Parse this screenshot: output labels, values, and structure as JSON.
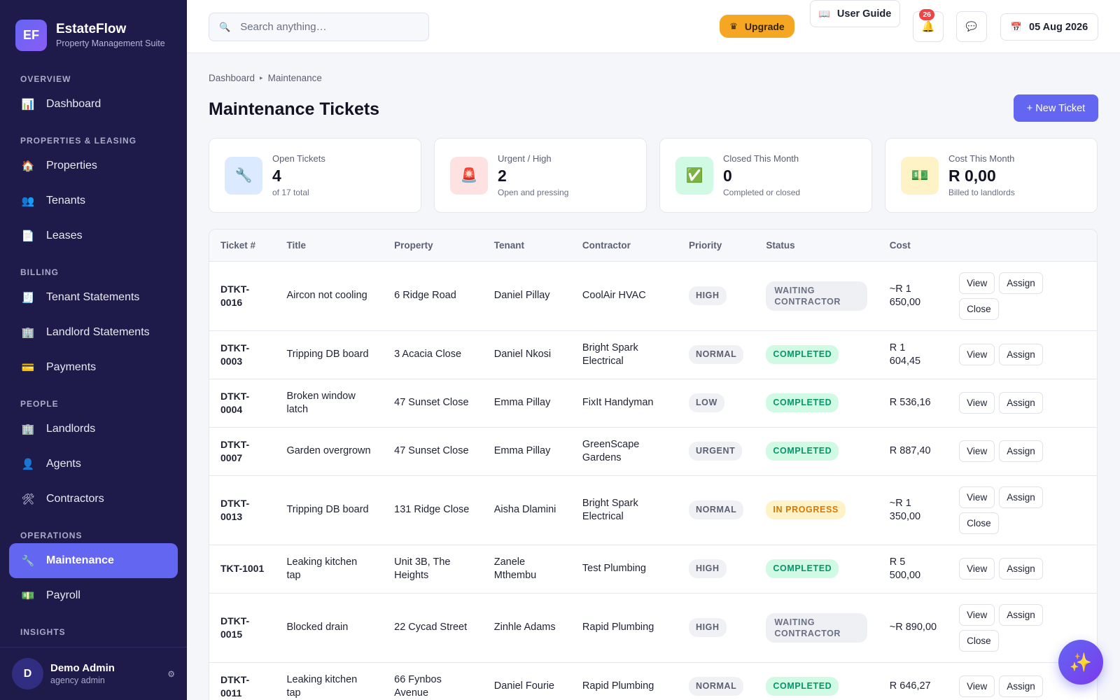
{
  "brand": {
    "logo": "EF",
    "name": "EstateFlow",
    "subtitle": "Property Management Suite"
  },
  "sidebar": {
    "sections": [
      {
        "title": "OVERVIEW",
        "items": [
          {
            "label": "Dashboard",
            "icon": "chart-icon"
          }
        ]
      },
      {
        "title": "PROPERTIES & LEASING",
        "items": [
          {
            "label": "Properties",
            "icon": "house-icon"
          },
          {
            "label": "Tenants",
            "icon": "people-icon"
          },
          {
            "label": "Leases",
            "icon": "document-icon"
          }
        ]
      },
      {
        "title": "BILLING",
        "items": [
          {
            "label": "Tenant Statements",
            "icon": "receipt-icon"
          },
          {
            "label": "Landlord Statements",
            "icon": "building-icon"
          },
          {
            "label": "Payments",
            "icon": "card-icon"
          }
        ]
      },
      {
        "title": "PEOPLE",
        "items": [
          {
            "label": "Landlords",
            "icon": "building-icon"
          },
          {
            "label": "Agents",
            "icon": "person-icon"
          },
          {
            "label": "Contractors",
            "icon": "tools-icon"
          }
        ]
      },
      {
        "title": "OPERATIONS",
        "items": [
          {
            "label": "Maintenance",
            "icon": "wrench-icon",
            "active": true
          },
          {
            "label": "Payroll",
            "icon": "money-icon"
          }
        ]
      },
      {
        "title": "INSIGHTS",
        "items": []
      }
    ],
    "user": {
      "initial": "D",
      "name": "Demo Admin",
      "role": "agency admin"
    }
  },
  "topbar": {
    "search_placeholder": "Search anything…",
    "upgrade_label": "Upgrade",
    "guide_label": "User Guide",
    "notification_count": "26",
    "date": "05 Aug 2026"
  },
  "breadcrumb": {
    "root": "Dashboard",
    "current": "Maintenance"
  },
  "page_title": "Maintenance Tickets",
  "new_ticket_label": "+ New Ticket",
  "stats": [
    {
      "label": "Open Tickets",
      "value": "4",
      "sub": "of 17 total",
      "icon": "wrench-icon",
      "bg": "#dbeafe"
    },
    {
      "label": "Urgent / High",
      "value": "2",
      "sub": "Open and pressing",
      "icon": "siren-icon",
      "bg": "#fee2e2"
    },
    {
      "label": "Closed This Month",
      "value": "0",
      "sub": "Completed or closed",
      "icon": "check-icon",
      "bg": "#d1fae5"
    },
    {
      "label": "Cost This Month",
      "value": "R 0,00",
      "sub": "Billed to landlords",
      "icon": "money-icon",
      "bg": "#fef3c7"
    }
  ],
  "table": {
    "headers": [
      "Ticket #",
      "Title",
      "Property",
      "Tenant",
      "Contractor",
      "Priority",
      "Status",
      "Cost",
      ""
    ],
    "rows": [
      {
        "ticket": "DTKT-0016",
        "title": "Aircon not cooling",
        "property": "6 Ridge Road",
        "tenant": "Daniel Pillay",
        "contractor": "CoolAir HVAC",
        "priority": "HIGH",
        "status": "WAITING CONTRACTOR",
        "status_kind": "wait",
        "cost": "~R 1 650,00",
        "actions": [
          "View",
          "Assign",
          "Close"
        ]
      },
      {
        "ticket": "DTKT-0003",
        "title": "Tripping DB board",
        "property": "3 Acacia Close",
        "tenant": "Daniel Nkosi",
        "contractor": "Bright Spark Electrical",
        "priority": "NORMAL",
        "status": "COMPLETED",
        "status_kind": "done",
        "cost": "R 1 604,45",
        "actions": [
          "View",
          "Assign"
        ]
      },
      {
        "ticket": "DTKT-0004",
        "title": "Broken window latch",
        "property": "47 Sunset Close",
        "tenant": "Emma Pillay",
        "contractor": "FixIt Handyman",
        "priority": "LOW",
        "status": "COMPLETED",
        "status_kind": "done",
        "cost": "R 536,16",
        "actions": [
          "View",
          "Assign"
        ]
      },
      {
        "ticket": "DTKT-0007",
        "title": "Garden overgrown",
        "property": "47 Sunset Close",
        "tenant": "Emma Pillay",
        "contractor": "GreenScape Gardens",
        "priority": "URGENT",
        "status": "COMPLETED",
        "status_kind": "done",
        "cost": "R 887,40",
        "actions": [
          "View",
          "Assign"
        ]
      },
      {
        "ticket": "DTKT-0013",
        "title": "Tripping DB board",
        "property": "131 Ridge Close",
        "tenant": "Aisha Dlamini",
        "contractor": "Bright Spark Electrical",
        "priority": "NORMAL",
        "status": "IN PROGRESS",
        "status_kind": "prog",
        "cost": "~R 1 350,00",
        "actions": [
          "View",
          "Assign",
          "Close"
        ]
      },
      {
        "ticket": "TKT-1001",
        "title": "Leaking kitchen tap",
        "property": "Unit 3B, The Heights",
        "tenant": "Zanele Mthembu",
        "contractor": "Test Plumbing",
        "priority": "HIGH",
        "status": "COMPLETED",
        "status_kind": "done",
        "cost": "R 5 500,00",
        "actions": [
          "View",
          "Assign"
        ]
      },
      {
        "ticket": "DTKT-0015",
        "title": "Blocked drain",
        "property": "22 Cycad Street",
        "tenant": "Zinhle Adams",
        "contractor": "Rapid Plumbing",
        "priority": "HIGH",
        "status": "WAITING CONTRACTOR",
        "status_kind": "wait",
        "cost": "~R 890,00",
        "actions": [
          "View",
          "Assign",
          "Close"
        ]
      },
      {
        "ticket": "DTKT-0011",
        "title": "Leaking kitchen tap",
        "property": "66 Fynbos Avenue",
        "tenant": "Daniel Fourie",
        "contractor": "Rapid Plumbing",
        "priority": "NORMAL",
        "status": "COMPLETED",
        "status_kind": "done",
        "cost": "R 646,27",
        "actions": [
          "View",
          "Assign"
        ]
      }
    ]
  },
  "fab_icon": "sparkles-icon"
}
